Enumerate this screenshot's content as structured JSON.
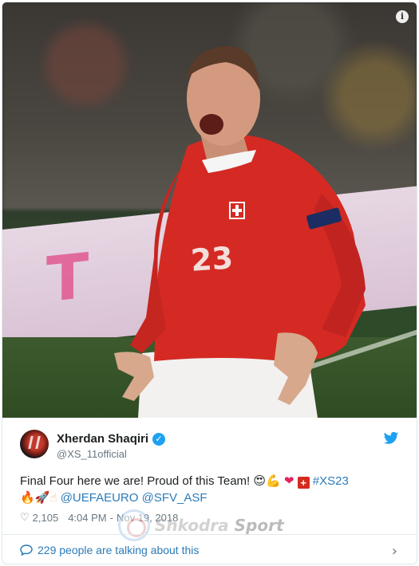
{
  "photo": {
    "alt_subject": "player celebrating",
    "info_icon": "i",
    "board_text_1": "T",
    "board_text_2": "",
    "jersey_number": "23"
  },
  "tweet": {
    "author_name": "Xherdan Shaqiri",
    "author_handle": "@XS_11official",
    "verified_icon": "check-badge-icon",
    "text_main": "Final Four here we are! Proud of this Team!",
    "emoji_1": "😍",
    "emoji_2": "💪",
    "emoji_3": "❤",
    "flag_char": "+",
    "hashtag": "#XS23",
    "emoji_4": "🔥",
    "emoji_5": "🚀",
    "emoji_6": "☝",
    "mention_1": "@UEFAEURO",
    "mention_2": "@SFV_ASF",
    "likes": "2,105",
    "time": "4:04 PM",
    "date_sep": "-",
    "date": "Nov 19, 2018",
    "watermark_a": "Shkodra",
    "watermark_b": "Sport"
  },
  "footer": {
    "talk_text": "229 people are talking about this",
    "chevron": "›"
  },
  "colors": {
    "link": "#2b7bb9",
    "verified": "#1da1f2",
    "jersey": "#d42a23"
  }
}
